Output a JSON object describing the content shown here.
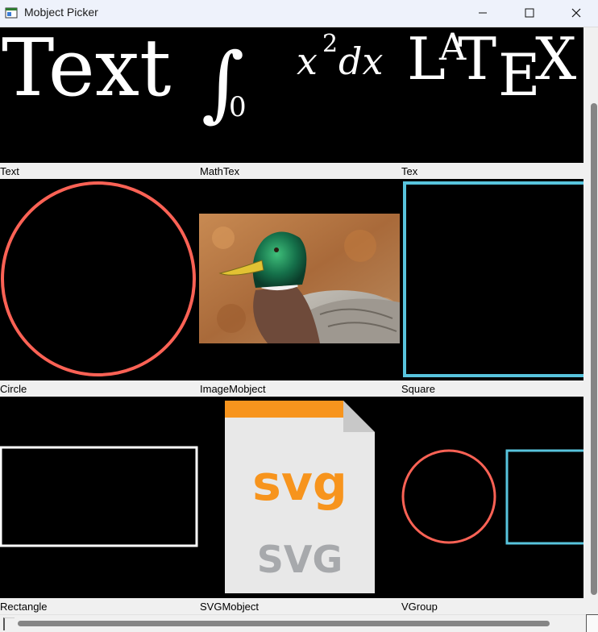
{
  "window": {
    "title": "Mobject Picker",
    "icon": "app-window-icon",
    "controls": [
      "minimize-icon",
      "maximize-icon",
      "close-icon"
    ]
  },
  "previews": {
    "text_sample": "Text",
    "mathtex_sample_integral": "∫",
    "mathtex_sample_sub": "0",
    "mathtex_sample_x": "x",
    "mathtex_sample_sup": "2",
    "mathtex_sample_dx": "dx",
    "tex_sample": "LATEX",
    "svg_orange_text": "svg",
    "svg_gray_text": "SVG",
    "image_subject": "duck-photo"
  },
  "items": [
    {
      "caption": "Text"
    },
    {
      "caption": "MathTex"
    },
    {
      "caption": "Tex"
    },
    {
      "caption": "Circle"
    },
    {
      "caption": "ImageMobject"
    },
    {
      "caption": "Square"
    },
    {
      "caption": "Rectangle"
    },
    {
      "caption": "SVGMobject"
    },
    {
      "caption": "VGroup"
    }
  ],
  "colors": {
    "preview_bg": "#000000",
    "circle_red": "#fc6255",
    "square_blue": "#58c4dd",
    "white": "#ffffff",
    "svg_orange": "#f7941d",
    "svg_gray": "#a7a9ac",
    "svg_page": "#e8e8e8"
  }
}
